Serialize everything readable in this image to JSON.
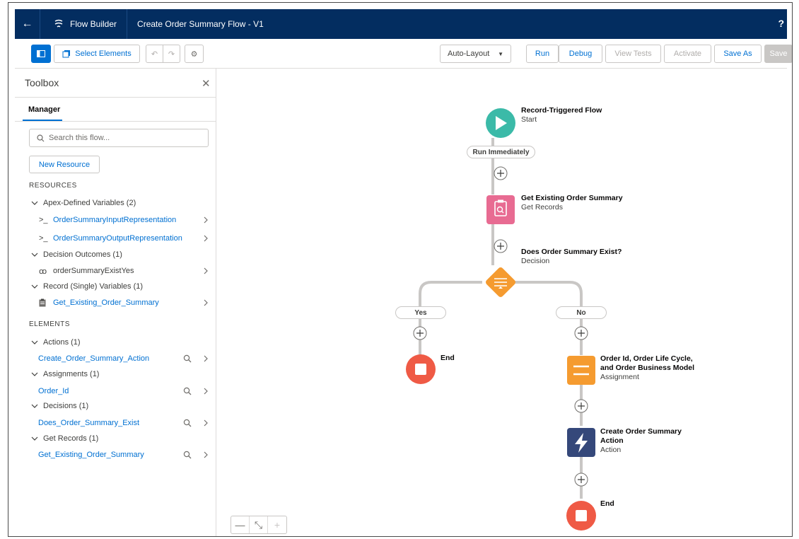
{
  "header": {
    "back_icon": "arrow-left-icon",
    "app_name": "Flow Builder",
    "flow_title": "Create Order Summary Flow - V1",
    "help_label": "?"
  },
  "toolbar": {
    "select_elements": "Select Elements",
    "auto_layout": "Auto-Layout",
    "run": "Run",
    "debug": "Debug",
    "view_tests": "View Tests",
    "activate": "Activate",
    "save_as": "Save As",
    "save": "Save"
  },
  "sidebar": {
    "title": "Toolbox",
    "tab_manager": "Manager",
    "search_placeholder": "Search this flow...",
    "new_resource": "New Resource",
    "resources_title": "RESOURCES",
    "elements_title": "ELEMENTS",
    "resource_groups": [
      {
        "label": "Apex-Defined Variables (2)",
        "items": [
          {
            "icon": ">_",
            "label": "OrderSummaryInputRepresentation"
          },
          {
            "icon": ">_",
            "label": "OrderSummaryOutputRepresentation"
          }
        ]
      },
      {
        "label": "Decision Outcomes (1)",
        "items": [
          {
            "icon": "ꝏ",
            "label": "orderSummaryExistYes"
          }
        ]
      },
      {
        "label": "Record (Single) Variables (1)",
        "items": [
          {
            "icon": "clipboard-icon",
            "label": "Get_Existing_Order_Summary"
          }
        ]
      }
    ],
    "element_groups": [
      {
        "label": "Actions (1)",
        "items": [
          {
            "label": "Create_Order_Summary_Action"
          }
        ]
      },
      {
        "label": "Assignments (1)",
        "items": [
          {
            "label": "Order_Id"
          }
        ]
      },
      {
        "label": "Decisions (1)",
        "items": [
          {
            "label": "Does_Order_Summary_Exist"
          }
        ]
      },
      {
        "label": "Get Records (1)",
        "items": [
          {
            "label": "Get_Existing_Order_Summary"
          }
        ]
      }
    ]
  },
  "canvas": {
    "start": {
      "title": "Record-Triggered Flow",
      "subtitle": "Start"
    },
    "run_immediately": "Run Immediately",
    "get_records": {
      "title": "Get Existing Order Summary",
      "subtitle": "Get Records"
    },
    "decision": {
      "title": "Does Order Summary Exist?",
      "subtitle": "Decision"
    },
    "branch_yes": "Yes",
    "branch_no": "No",
    "end_left": "End",
    "assignment": {
      "title_line1": "Order Id, Order Life Cycle,",
      "title_line2": "and Order Business Model",
      "subtitle": "Assignment"
    },
    "action": {
      "title_line1": "Create Order Summary",
      "title_line2": "Action",
      "subtitle": "Action"
    },
    "end_right": "End",
    "colors": {
      "start": "#3bbaa8",
      "get_records": "#e86b92",
      "decision": "#f59b30",
      "assignment": "#f59b30",
      "action": "#35487a",
      "end": "#ef5a45",
      "connector": "#c9c7c5"
    }
  },
  "zoom": {
    "zoom_out": "—",
    "fit": "⤡",
    "zoom_in": "+"
  }
}
